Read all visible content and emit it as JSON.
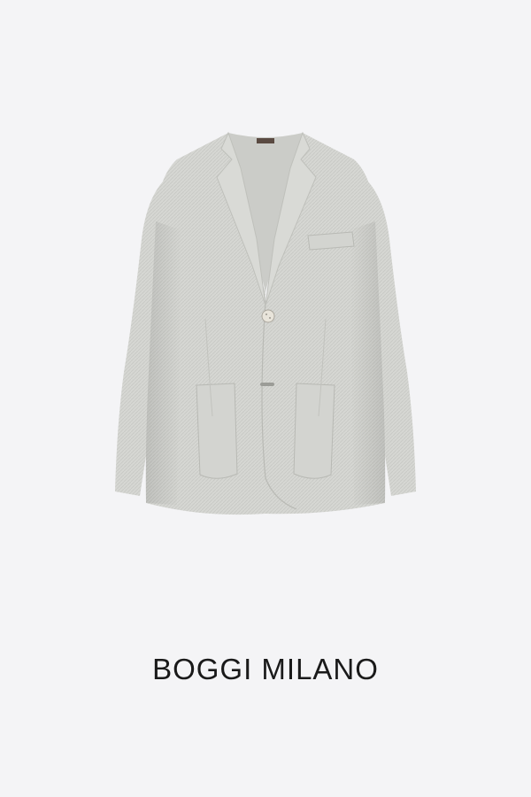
{
  "brand": {
    "name": "BOGGI MILANO"
  },
  "product": {
    "image": "light-grey-blazer"
  },
  "colors": {
    "background": "#f4f4f6",
    "garment": "#d5d6d2",
    "brand_text": "#1a1a1a"
  }
}
